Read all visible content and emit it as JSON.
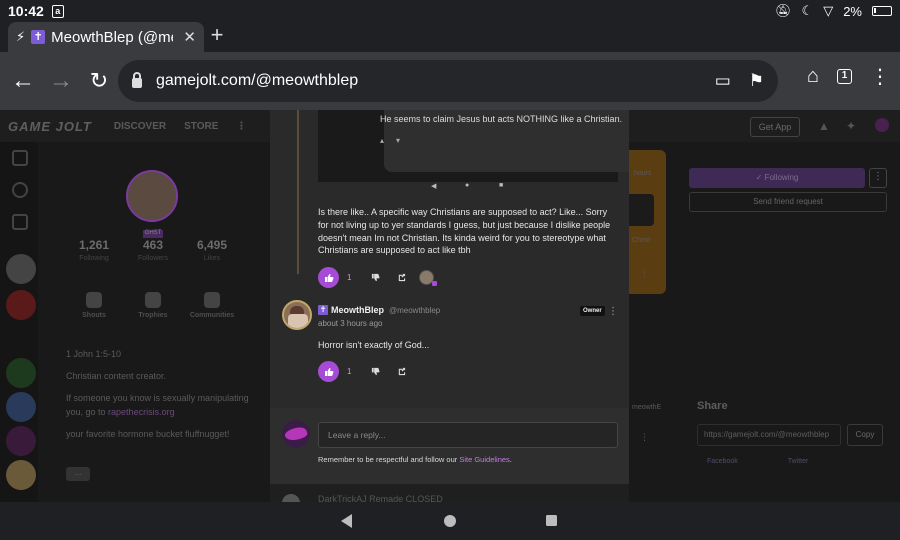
{
  "status_bar": {
    "time": "10:42",
    "notif_badge": "a",
    "battery": "2%"
  },
  "tab": {
    "title": "MeowthBlep (@meowthblep)",
    "cross": "✝"
  },
  "omnibox": {
    "url": "gamejolt.com/@meowthblep",
    "tab_count": "1"
  },
  "gj_nav": {
    "logo": "GAME JOLT",
    "discover": "DISCOVER",
    "store": "STORE",
    "get_app": "Get App"
  },
  "profile": {
    "ghost_label": "GHST",
    "stats": [
      {
        "value": "1,261",
        "label": "Following"
      },
      {
        "value": "463",
        "label": "Followers"
      },
      {
        "value": "6,495",
        "label": "Likes"
      }
    ],
    "nav": [
      "Shouts",
      "Trophies",
      "Communities"
    ],
    "bio_verse": "1 John 1:5-10",
    "bio_line1": "Christian content creator.",
    "bio_line2_a": "If someone you know is sexually manipulating you, go to",
    "bio_line2_link": "rapethecrisis.org",
    "bio_line3": "your favorite hormone bucket fluffnugget!",
    "more_label": "..."
  },
  "right_panel": {
    "following_label": "Following",
    "send_request": "Send friend request",
    "share_heading": "Share",
    "share_url": "https://gamejolt.com/@meowthblep",
    "copy_label": "Copy",
    "facebook": "Facebook",
    "twitter": "Twitter",
    "side_hours": "hours",
    "side_christ": "Christ",
    "side_user": "meowthE"
  },
  "thread": {
    "image_caption": "He seems to claim Jesus but acts NOTHING like a Christian.",
    "comment1_text": "Is there like.. A specific way Christians are supposed to act? Like... Sorry for not living up to yer standards I guess, but just because I dislike people doesn't mean Im not Christian. Its kinda weird for you to stereotype what Christians are supposed to act like tbh",
    "comment1_likes": "1",
    "comment2": {
      "name": "MeowthBlep",
      "handle": "@meowthblep",
      "time": "about 3 hours ago",
      "badge": "Owner",
      "text": "Horror isn't exactly of God...",
      "likes": "1"
    }
  },
  "reply": {
    "placeholder": "Leave a reply...",
    "note": "Remember to be respectful and follow our",
    "link": "Site Guidelines",
    "note_end": "."
  },
  "peek": {
    "text": "DarkTrickAJ Remade CLOSED"
  },
  "colors": {
    "accent": "#a64bd6",
    "link": "#c57de8"
  }
}
